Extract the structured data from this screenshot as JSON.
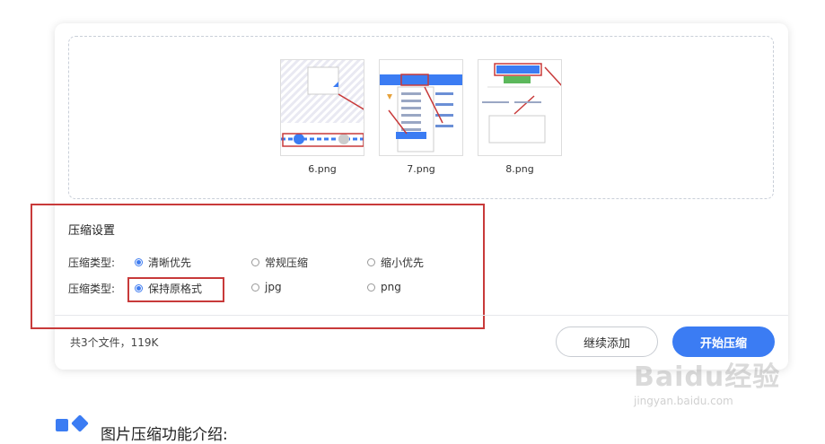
{
  "files": [
    {
      "name": "6.png"
    },
    {
      "name": "7.png"
    },
    {
      "name": "8.png"
    }
  ],
  "settings": {
    "title": "压缩设置",
    "rows": [
      {
        "label": "压缩类型:",
        "options": [
          "清晰优先",
          "常规压缩",
          "缩小优先"
        ],
        "selected": "清晰优先"
      },
      {
        "label": "压缩类型:",
        "options": [
          "保持原格式",
          "jpg",
          "png"
        ],
        "selected": "保持原格式"
      }
    ]
  },
  "footer": {
    "summary": "共3个文件，119K",
    "add_label": "继续添加",
    "start_label": "开始压缩"
  },
  "section": {
    "title": "图片压缩功能介绍:"
  },
  "watermark": {
    "main": "Baidu经验",
    "sub": "jingyan.baidu.com"
  },
  "colors": {
    "accent": "#3b7cf3",
    "highlight": "#c83a3a"
  }
}
